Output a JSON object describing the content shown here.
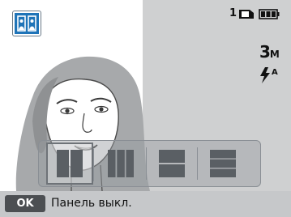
{
  "status": {
    "shot_count": "1",
    "resolution": "3",
    "resolution_unit": "M",
    "flash_mode_letter": "A"
  },
  "icons": {
    "mode": "split-shot-mode-icon",
    "card": "memory-card-icon",
    "battery": "battery-full-icon",
    "flash": "flash-auto-icon"
  },
  "layout_options": [
    {
      "name": "two-vertical-panels",
      "selected": true
    },
    {
      "name": "three-vertical-panels",
      "selected": false
    },
    {
      "name": "two-horizontal-panels",
      "selected": false
    },
    {
      "name": "three-horizontal-panels",
      "selected": false
    }
  ],
  "bottom_bar": {
    "ok_key": "OK",
    "hint": "Панель выкл."
  },
  "colors": {
    "mode_icon_bg": "#1f74b8",
    "right_pane": "#cfd0d1",
    "bottom_bar": "#c6c8ca",
    "ok_key_bg": "#4c4f52"
  }
}
